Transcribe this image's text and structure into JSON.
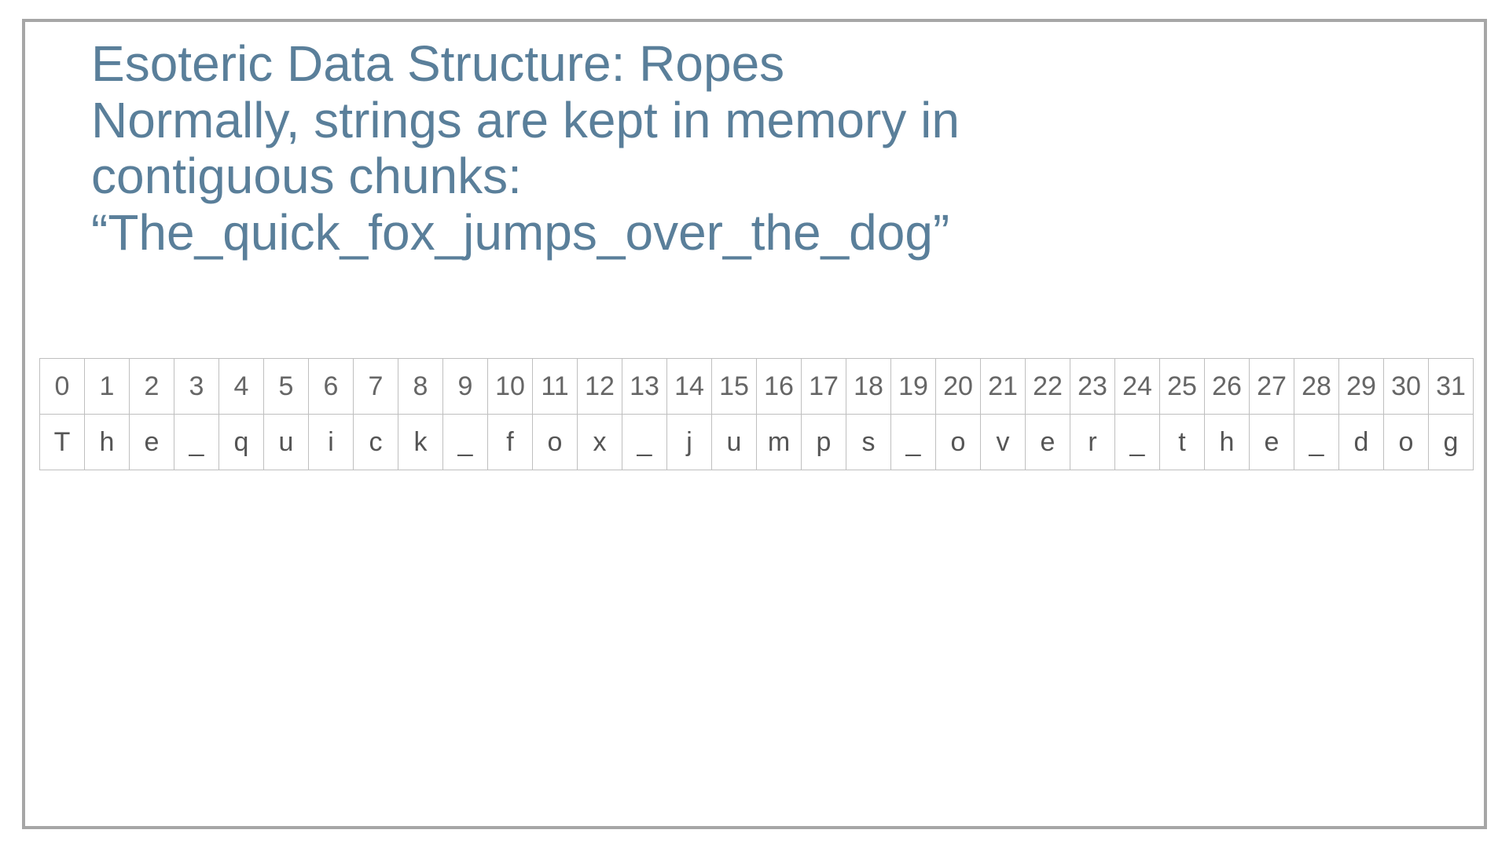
{
  "heading": {
    "line1": "Esoteric Data Structure: Ropes",
    "line2": "Normally, strings are kept in memory in",
    "line3": "contiguous chunks:",
    "line4": "“The_quick_fox_jumps_over_the_dog”"
  },
  "array": {
    "indices": [
      "0",
      "1",
      "2",
      "3",
      "4",
      "5",
      "6",
      "7",
      "8",
      "9",
      "10",
      "11",
      "12",
      "13",
      "14",
      "15",
      "16",
      "17",
      "18",
      "19",
      "20",
      "21",
      "22",
      "23",
      "24",
      "25",
      "26",
      "27",
      "28",
      "29",
      "30",
      "31"
    ],
    "chars": [
      "T",
      "h",
      "e",
      "_",
      "q",
      "u",
      "i",
      "c",
      "k",
      "_",
      "f",
      "o",
      "x",
      "_",
      "j",
      "u",
      "m",
      "p",
      "s",
      "_",
      "o",
      "v",
      "e",
      "r",
      "_",
      "t",
      "h",
      "e",
      "_",
      "d",
      "o",
      "g"
    ]
  }
}
